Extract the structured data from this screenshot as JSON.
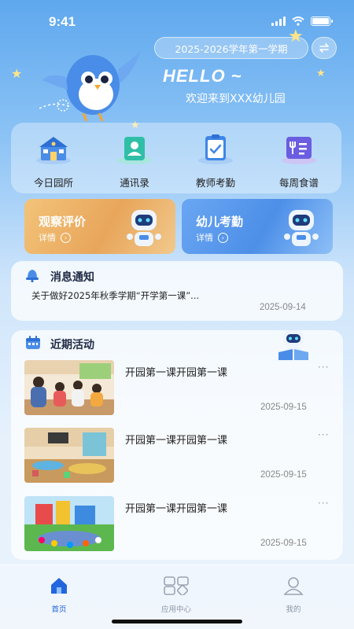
{
  "status_bar": {
    "time": "9:41"
  },
  "header": {
    "semester": "2025-2026学年第一学期",
    "hello": "HELLO ~",
    "welcome": "欢迎来到XXX幼儿园"
  },
  "quick_nav": [
    {
      "label": "今日园所",
      "icon": "school-icon"
    },
    {
      "label": "通讯录",
      "icon": "contacts-icon"
    },
    {
      "label": "教师考勤",
      "icon": "clipboard-check-icon"
    },
    {
      "label": "每周食谱",
      "icon": "menu-utensils-icon"
    }
  ],
  "promos": [
    {
      "title": "观察评价",
      "detail": "详情",
      "color": "#f0b86a"
    },
    {
      "title": "幼儿考勤",
      "detail": "详情",
      "color": "#5f9ef0"
    }
  ],
  "notice": {
    "title": "消息通知",
    "text": "关于做好2025年秋季学期“开学第一课”...",
    "date": "2025-09-14"
  },
  "activities": {
    "title": "近期活动",
    "items": [
      {
        "title": "开园第一课开园第一课",
        "date": "2025-09-15",
        "more": "···"
      },
      {
        "title": "开园第一课开园第一课",
        "date": "2025-09-15",
        "more": "···"
      },
      {
        "title": "开园第一课开园第一课",
        "date": "2025-09-15",
        "more": "···"
      }
    ]
  },
  "tabbar": [
    {
      "label": "首页",
      "active": true
    },
    {
      "label": "应用中心",
      "active": false
    },
    {
      "label": "我的",
      "active": false
    }
  ],
  "colors": {
    "accent": "#2166dd",
    "sky": "#5fa8ee"
  }
}
